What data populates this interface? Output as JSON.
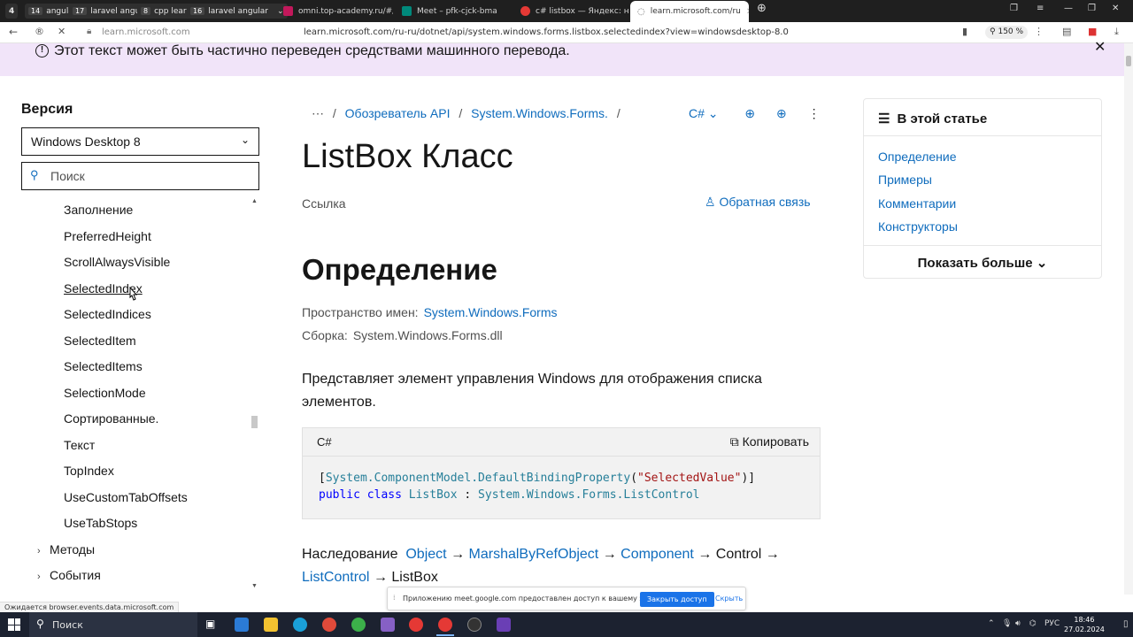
{
  "browser": {
    "tab_groups": [
      {
        "count": "14",
        "label": "angular"
      },
      {
        "count": "17",
        "label": "laravel angular"
      },
      {
        "count": "8",
        "label": "cpp learn"
      },
      {
        "count": "16",
        "label": "laravel angular"
      }
    ],
    "tabs": [
      {
        "title": "omni.top-academy.ru/#/p",
        "active": false
      },
      {
        "title": "Meet – pfk-cjck-bma",
        "active": false
      },
      {
        "title": "c# listbox — Яндекс: наш",
        "active": false
      },
      {
        "title": "learn.microsoft.com/ru",
        "active": true
      }
    ],
    "address": {
      "host": "learn.microsoft.com",
      "url": "learn.microsoft.com/ru-ru/dotnet/api/system.windows.forms.listbox.selectedindex?view=windowsdesktop-8.0",
      "zoom": "150 %"
    },
    "status_url": "Ожидается browser.events.data.microsoft.com"
  },
  "banner": {
    "text": "Этот текст может быть частично переведен средствами машинного перевода."
  },
  "sidebar": {
    "version_label": "Версия",
    "version_value": "Windows Desktop 8",
    "search_placeholder": "Поиск",
    "items": [
      "Заполнение",
      "PreferredHeight",
      "ScrollAlwaysVisible",
      "SelectedIndex",
      "SelectedIndices",
      "SelectedItem",
      "SelectedItems",
      "SelectionMode",
      "Сортированные.",
      "Текст",
      "TopIndex",
      "UseCustomTabOffsets",
      "UseTabStops"
    ],
    "groups": [
      "Методы",
      "События"
    ]
  },
  "main": {
    "breadcrumb": {
      "ellipsis": "⋯",
      "items": [
        "Обозреватель API",
        "System.Windows.Forms."
      ],
      "lang": "C#"
    },
    "title": "ListBox Класс",
    "ref_label": "Ссылка",
    "feedback": "Обратная связь",
    "definition_heading": "Определение",
    "namespace_label": "Пространство имен:",
    "namespace_value": "System.Windows.Forms",
    "assembly_label": "Сборка:",
    "assembly_value": "System.Windows.Forms.dll",
    "description": "Представляет элемент управления Windows для отображения списка элементов.",
    "code": {
      "lang": "C#",
      "copy_label": "Копировать",
      "line1": {
        "open": "[",
        "type": "System.ComponentModel.DefaultBindingProperty",
        "paren_open": "(",
        "string": "\"SelectedValue\"",
        "close": ")]"
      },
      "line2": {
        "kw1": "public",
        "kw2": "class",
        "name": "ListBox",
        "colon": " : ",
        "base": "System.Windows.Forms.ListControl"
      }
    },
    "inheritance": {
      "label": "Наследование",
      "chain": [
        "Object",
        "MarshalByRefObject",
        "Component",
        "Control",
        "ListControl",
        "ListBox"
      ],
      "arrow": "→"
    }
  },
  "right_panel": {
    "title": "В этой статье",
    "links": [
      "Определение",
      "Примеры",
      "Комментарии",
      "Конструкторы"
    ],
    "show_more": "Показать больше"
  },
  "sharebar": {
    "text": "Приложению meet.google.com предоставлен доступ к вашему экрану.",
    "stop_label": "Закрыть доступ",
    "hide_label": "Скрыть"
  },
  "taskbar": {
    "search_label": "Поиск",
    "lang": "РУС",
    "time": "18:46",
    "date": "27.02.2024"
  },
  "colors": {
    "link": "#0f6cbd",
    "banner_bg": "#f1e4f9",
    "code_bg": "#f2f2f2",
    "share_button": "#1a73e8"
  }
}
